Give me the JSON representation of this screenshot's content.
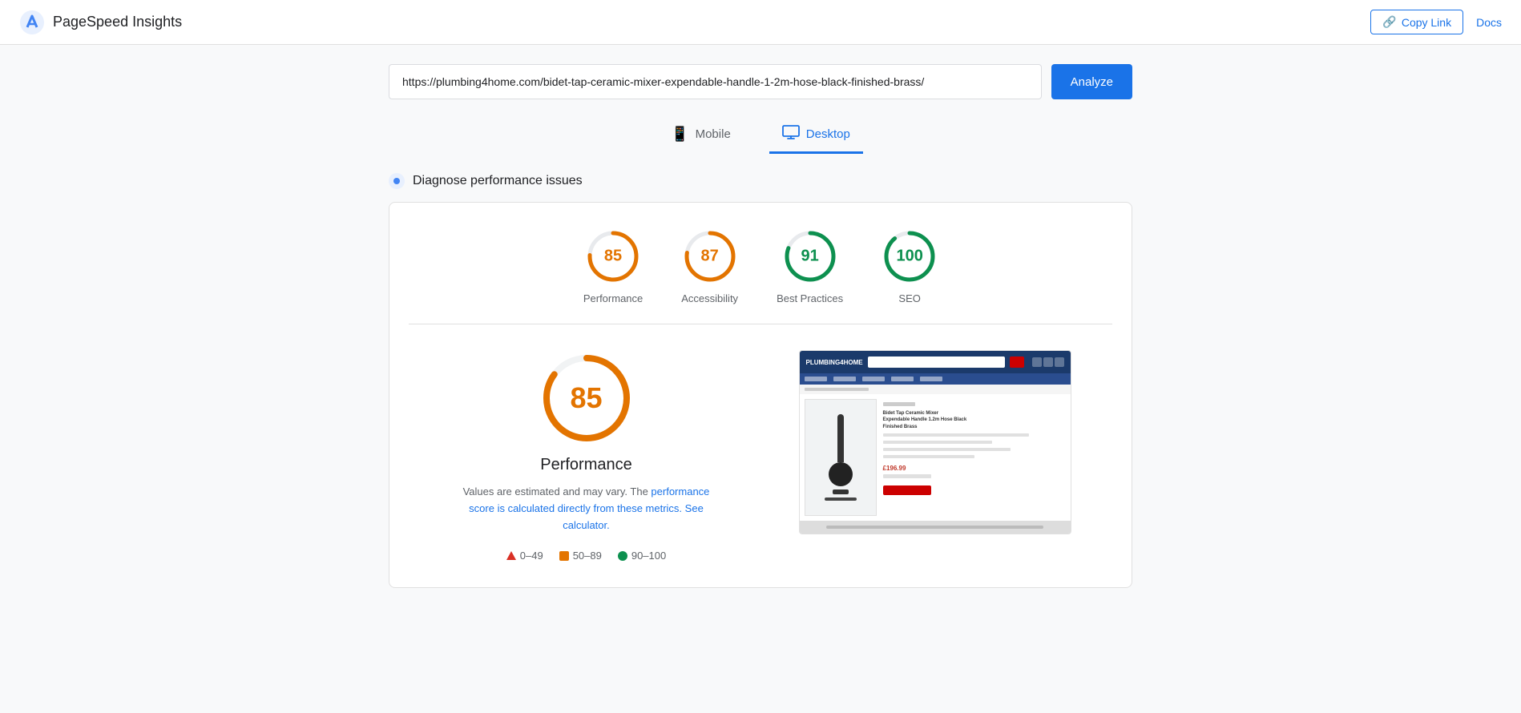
{
  "header": {
    "app_name": "PageSpeed Insights",
    "copy_link_label": "Copy Link",
    "docs_label": "Docs"
  },
  "url_bar": {
    "value": "https://plumbing4home.com/bidet-tap-ceramic-mixer-expendable-handle-1-2m-hose-black-finished-brass/",
    "placeholder": "Enter a web page URL"
  },
  "analyze_button": {
    "label": "Analyze"
  },
  "device_tabs": [
    {
      "id": "mobile",
      "label": "Mobile",
      "icon": "📱",
      "active": false
    },
    {
      "id": "desktop",
      "label": "Desktop",
      "icon": "🖥",
      "active": true
    }
  ],
  "section": {
    "title": "Diagnose performance issues"
  },
  "scores": [
    {
      "id": "performance",
      "value": 85,
      "label": "Performance",
      "color": "orange",
      "pct": 85
    },
    {
      "id": "accessibility",
      "value": 87,
      "label": "Accessibility",
      "color": "orange",
      "pct": 87
    },
    {
      "id": "best-practices",
      "value": 91,
      "label": "Best Practices",
      "color": "green",
      "pct": 91
    },
    {
      "id": "seo",
      "value": 100,
      "label": "SEO",
      "color": "green",
      "pct": 100
    }
  ],
  "detail": {
    "score": 85,
    "title": "Performance",
    "description_static": "Values are estimated and may vary. The",
    "description_link1": "performance score is calculated",
    "description_link1_suffix": "directly from these metrics.",
    "description_link2": "See calculator.",
    "legend": [
      {
        "id": "fail",
        "range": "0–49",
        "type": "triangle",
        "color": "#d93025"
      },
      {
        "id": "average",
        "range": "50–89",
        "type": "square",
        "color": "#e37400"
      },
      {
        "id": "pass",
        "range": "90–100",
        "type": "circle",
        "color": "#0d904f"
      }
    ]
  }
}
